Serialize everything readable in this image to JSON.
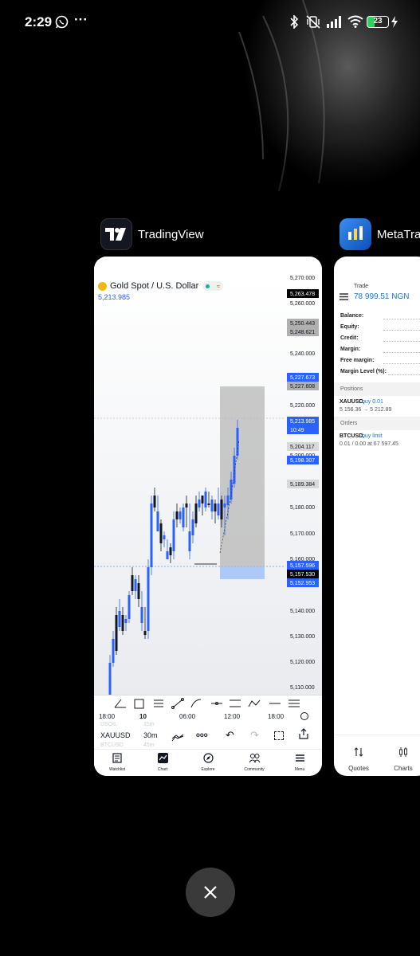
{
  "status_bar": {
    "time": "2:29",
    "more": "···",
    "battery": "23"
  },
  "apps": [
    {
      "name": "TradingView",
      "icon": "tradingview-logo-icon"
    },
    {
      "name": "MetaTrac",
      "icon": "metatrader-logo-icon"
    }
  ],
  "tradingview": {
    "symbol_title": "Gold Spot / U.S. Dollar",
    "current_price": "5,213.985",
    "price_axis": [
      "5,270.000",
      "5,260.000",
      "5,250.443",
      "5,248.621",
      "5,240.000",
      "5,227.673",
      "5,227.608",
      "5,220.000",
      "5,213.985",
      "10:49",
      "5,204.117",
      "5,200.000",
      "5,198.307",
      "5,189.384",
      "5,180.000",
      "5,170.000",
      "5,160.000",
      "5,157.596",
      "5,157.530",
      "5,152.953",
      "5,140.000",
      "5,130.000",
      "5,120.000",
      "5,110.000"
    ],
    "top_tag": "5,263.478",
    "time_axis": [
      "18:00",
      "10",
      "06:00",
      "12:00",
      "18:00"
    ],
    "bottom_bar": {
      "ticker": "XAUUSD",
      "interval": "30m",
      "ghost_ticker_1": "USOIL",
      "ghost_interval_1": "15m",
      "ghost_ticker_2": "BTCUSD",
      "ghost_interval_2": "45m",
      "dots": "ooo"
    },
    "nav": [
      {
        "label": "Watchlist",
        "icon": "watchlist-icon"
      },
      {
        "label": "Chart",
        "icon": "chart-icon"
      },
      {
        "label": "Explore",
        "icon": "explore-icon"
      },
      {
        "label": "Community",
        "icon": "community-icon"
      },
      {
        "label": "Menu",
        "icon": "menu-icon"
      }
    ],
    "colors": {
      "up": "#2962ff",
      "down": "#131722",
      "tag_blue": "#2962ff",
      "tag_black": "#000000"
    }
  },
  "metatrader": {
    "title": "Trade",
    "balance_display": "78 999.51 NGN",
    "fields": [
      "Balance:",
      "Equity:",
      "Credit:",
      "Margin:",
      "Free margin:",
      "Margin Level (%):"
    ],
    "positions_header": "Positions",
    "position": {
      "symbol": "XAUUSD,",
      "side": "buy 0.01",
      "detail": "5 156.36 → 5 212.89"
    },
    "orders_header": "Orders",
    "order": {
      "symbol": "BTCUSD,",
      "side": "buy limit",
      "detail": "0.01 / 0.00 at 67 597.45"
    },
    "nav": [
      {
        "label": "Quotes",
        "icon": "quotes-icon"
      },
      {
        "label": "Charts",
        "icon": "charts-icon"
      }
    ]
  }
}
